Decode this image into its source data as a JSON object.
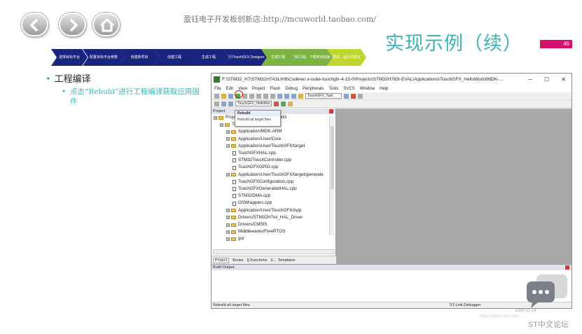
{
  "header": {
    "shop_text": "盈钰电子开发板创新店:http://mcuworld.taobao.com/"
  },
  "slide": {
    "title": "实现示例（续）",
    "page_number": "46"
  },
  "steps": [
    {
      "label": "选择目标平台",
      "color": "#1a237e"
    },
    {
      "label": "配置目标平台参数",
      "color": "#1a237e"
    },
    {
      "label": "创建新项目",
      "color": "#1a237e"
    },
    {
      "label": "创建工程",
      "color": "#1a237e"
    },
    {
      "label": "生成工程",
      "color": "#1a237e"
    },
    {
      "label": "执行TouchGFX Designer",
      "color": "#1a237e"
    },
    {
      "label": "生成工程",
      "color": "#7cb342"
    },
    {
      "label": "编译工程，下载到目标板",
      "color": "#7cb342"
    },
    {
      "label": "调试，运行并验证",
      "color": "#c0d630"
    }
  ],
  "content": {
    "bullet1": "工程编译",
    "bullet2": "点击“Rebuld”进行工程编译获取应用固件"
  },
  "ide": {
    "window_title": "F:\\STM32_H7\\STM32H7A3LIH6\\Code\\en.x-cube-touchgfx-4-15-0\\Projects\\STM32H783I-EVAL\\Applications\\TouchGFX_HelloWorld\\MDK-...",
    "menu": [
      "File",
      "Edit",
      "View",
      "Project",
      "Flash",
      "Debug",
      "Peripherals",
      "Tools",
      "SVCS",
      "Window",
      "Help"
    ],
    "target_select": "TouchGFX_HelloWor",
    "target_task": "TouchGFX_Task",
    "project_header": "Project",
    "tooltip_title": "Rebuild",
    "tooltip_desc": "Rebuild all target files",
    "tree": [
      {
        "label": "Project: TouchGFX_HelloWorld",
        "kind": "root",
        "level": 0
      },
      {
        "label": "TouchGFX_HelloWorld",
        "kind": "folder",
        "level": 1
      },
      {
        "label": "Application/MDK-ARM",
        "kind": "folder",
        "level": 2
      },
      {
        "label": "Application/User/Core",
        "kind": "folder",
        "level": 2
      },
      {
        "label": "Application/User/TouchGFX/target",
        "kind": "folder",
        "level": 2
      },
      {
        "label": "TouchGFXHAL.cpp",
        "kind": "file",
        "level": 3
      },
      {
        "label": "STM32TouchController.cpp",
        "kind": "file",
        "level": 3
      },
      {
        "label": "TouchGFXGPIO.cpp",
        "kind": "file",
        "level": 3
      },
      {
        "label": "Application/User/TouchGFX/target/generate",
        "kind": "folder",
        "level": 2
      },
      {
        "label": "TouchGFXConfiguration.cpp",
        "kind": "file",
        "level": 3
      },
      {
        "label": "TouchGFXGeneratedHAL.cpp",
        "kind": "file",
        "level": 3
      },
      {
        "label": "STM32DMA.cpp",
        "kind": "file",
        "level": 3
      },
      {
        "label": "OSWrappers.cpp",
        "kind": "file",
        "level": 3
      },
      {
        "label": "Application/User/TouchGFX/App",
        "kind": "folder",
        "level": 2
      },
      {
        "label": "Drivers/STM32H7xx_HAL_Driver",
        "kind": "folder",
        "level": 2
      },
      {
        "label": "Drivers/CMSIS",
        "kind": "folder",
        "level": 2
      },
      {
        "label": "Middlewares/FreeRTOS",
        "kind": "folder",
        "level": 2
      },
      {
        "label": "gui",
        "kind": "folder",
        "level": 2
      }
    ],
    "panel_tabs": [
      "Project",
      "Books",
      "{} Functions",
      "0→ Templates"
    ],
    "build_output_header": "Build Output",
    "status_text": "Rebuild all target files",
    "status_debugger": "ST-Link Debugger"
  },
  "watermark": {
    "date": "2020-12-14",
    "url": "https://blog.csdn.net/...",
    "brand": "ST中文论坛"
  }
}
